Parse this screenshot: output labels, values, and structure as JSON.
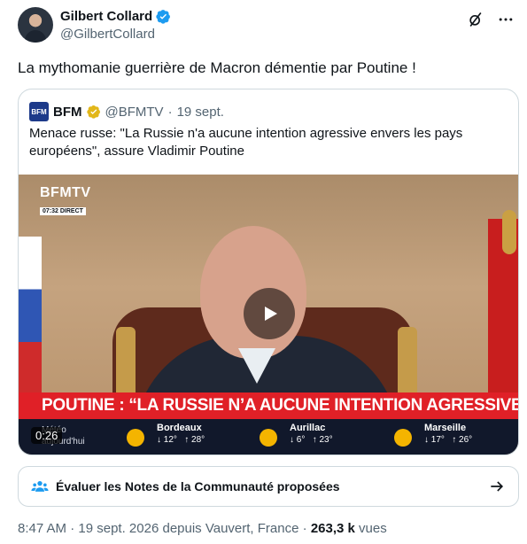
{
  "author": {
    "name": "Gilbert Collard",
    "handle": "@GilbertCollard",
    "verified_color": "#1d9bf0"
  },
  "top_actions": [
    "grok-slash-icon",
    "more-icon"
  ],
  "tweet_text": "La mythomanie guerrière de Macron démentie par Poutine !",
  "quoted": {
    "logo": "BFM",
    "name": "BFM",
    "badge_color": "#e2b719",
    "handle": "@BFMTV",
    "dot": "·",
    "date": "19 sept.",
    "text": "Menace russe: \"La Russie n'a aucune intention agressive envers les pays européens\", assure Vladimir Poutine",
    "video": {
      "channel": "BFMTV",
      "live_tag": "07:32 DIRECT",
      "headline": "POUTINE : “LA RUSSIE N’A AUCUNE INTENTION AGRESSIVE”",
      "duration": "0:26",
      "left_weather": "Météo\naujourd'hui",
      "weather": [
        {
          "city": "Bordeaux",
          "low": "↓ 12°",
          "high": "↑ 28°"
        },
        {
          "city": "Aurillac",
          "low": "↓ 6°",
          "high": "↑ 23°"
        },
        {
          "city": "Marseille",
          "low": "↓ 17°",
          "high": "↑ 26°"
        }
      ],
      "headline_color": "#e02027"
    }
  },
  "notes": {
    "label": "Évaluer les Notes de la Communauté proposées"
  },
  "meta": {
    "time": "8:47 AM",
    "date": "19 sept. 2026",
    "location": "depuis Vauvert, France",
    "views": "263,3 k",
    "views_label": "vues"
  }
}
